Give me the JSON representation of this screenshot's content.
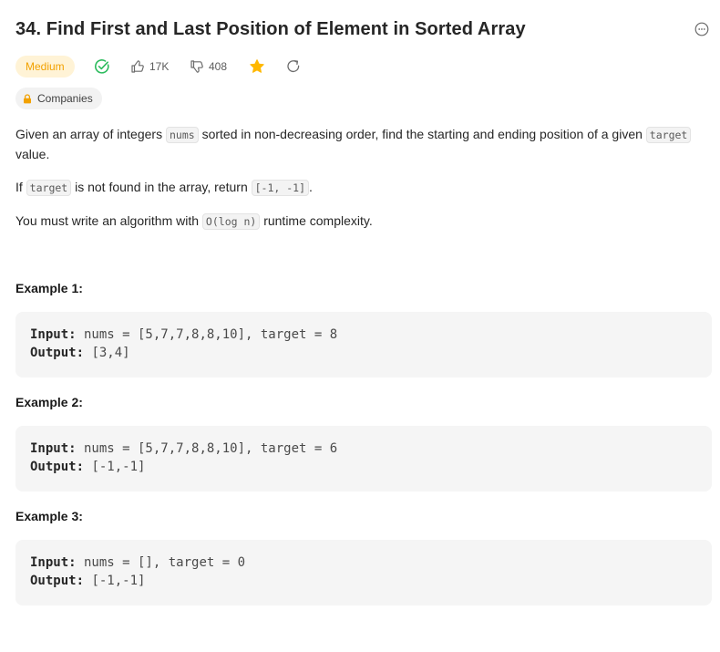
{
  "problem": {
    "title": "34. Find First and Last Position of Element in Sorted Array",
    "difficulty": "Medium",
    "likes": "17K",
    "dislikes": "408",
    "companies_label": "Companies"
  },
  "description": {
    "p1_before": "Given an array of integers ",
    "p1_code": "nums",
    "p1_middle": " sorted in non-decreasing order, find the starting and ending position of a given ",
    "p1_code2": "target",
    "p1_after": " value.",
    "p2_before": "If ",
    "p2_code": "target",
    "p2_middle": " is not found in the array, return ",
    "p2_code2": "[-1, -1]",
    "p2_after": ".",
    "p3_before": "You must write an algorithm with ",
    "p3_code": "O(log n)",
    "p3_after": " runtime complexity."
  },
  "examples": [
    {
      "heading": "Example 1:",
      "input_label": "Input:",
      "input_value": " nums = [5,7,7,8,8,10], target = 8",
      "output_label": "Output:",
      "output_value": " [3,4]"
    },
    {
      "heading": "Example 2:",
      "input_label": "Input:",
      "input_value": " nums = [5,7,7,8,8,10], target = 6",
      "output_label": "Output:",
      "output_value": " [-1,-1]"
    },
    {
      "heading": "Example 3:",
      "input_label": "Input:",
      "input_value": " nums = [], target = 0",
      "output_label": "Output:",
      "output_value": " [-1,-1]"
    }
  ],
  "colors": {
    "difficulty_bg": "#fff3d6",
    "difficulty_text": "#f2a100",
    "solved_green": "#2cbb5d",
    "star_gold": "#ffb800",
    "code_bg": "#f5f5f5"
  },
  "icons": {
    "more": "more-horizontal-icon",
    "solved": "check-circle-icon",
    "like": "thumbs-up-icon",
    "dislike": "thumbs-down-icon",
    "star": "star-icon",
    "share": "share-icon",
    "lock": "lock-icon"
  }
}
